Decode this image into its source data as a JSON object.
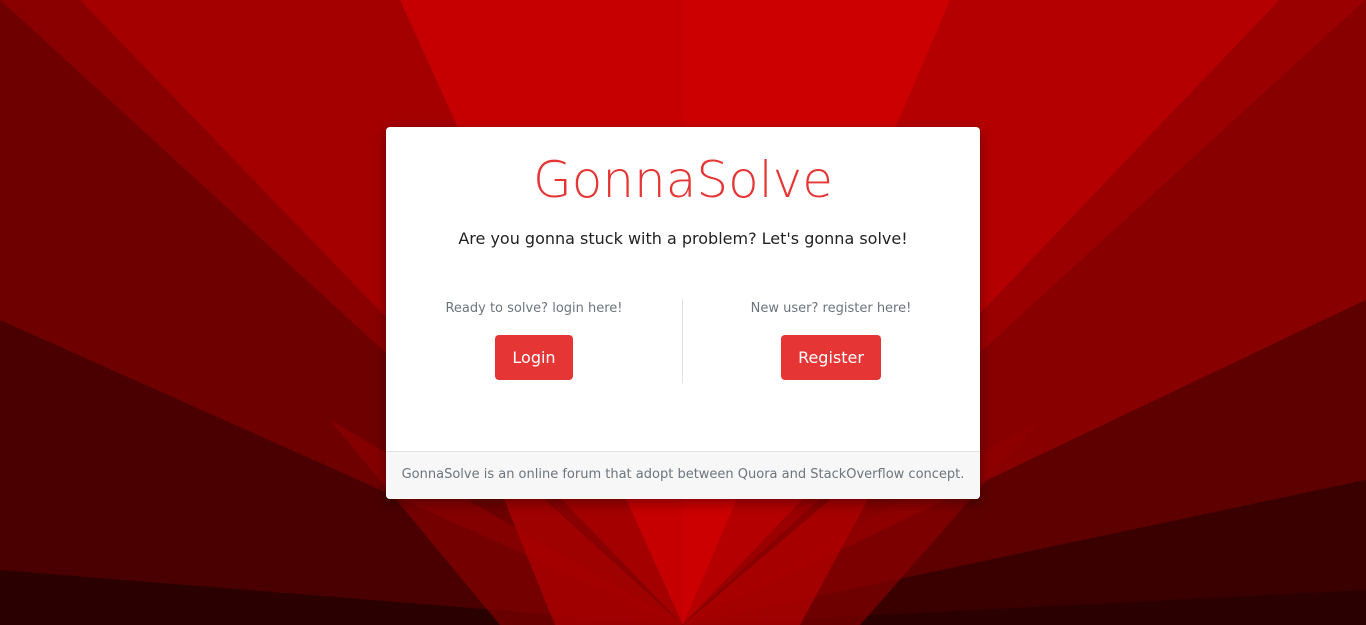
{
  "brand": {
    "title": "GonnaSolve"
  },
  "tagline": "Are you gonna stuck with a problem? Let's gonna solve!",
  "login": {
    "hint": "Ready to solve? login here!",
    "button_label": "Login"
  },
  "register": {
    "hint": "New user? register here!",
    "button_label": "Register"
  },
  "footer": {
    "text": "GonnaSolve is an online forum that adopt between Quora and StackOverflow concept."
  },
  "colors": {
    "accent": "#e53535",
    "background": "#c80000"
  }
}
